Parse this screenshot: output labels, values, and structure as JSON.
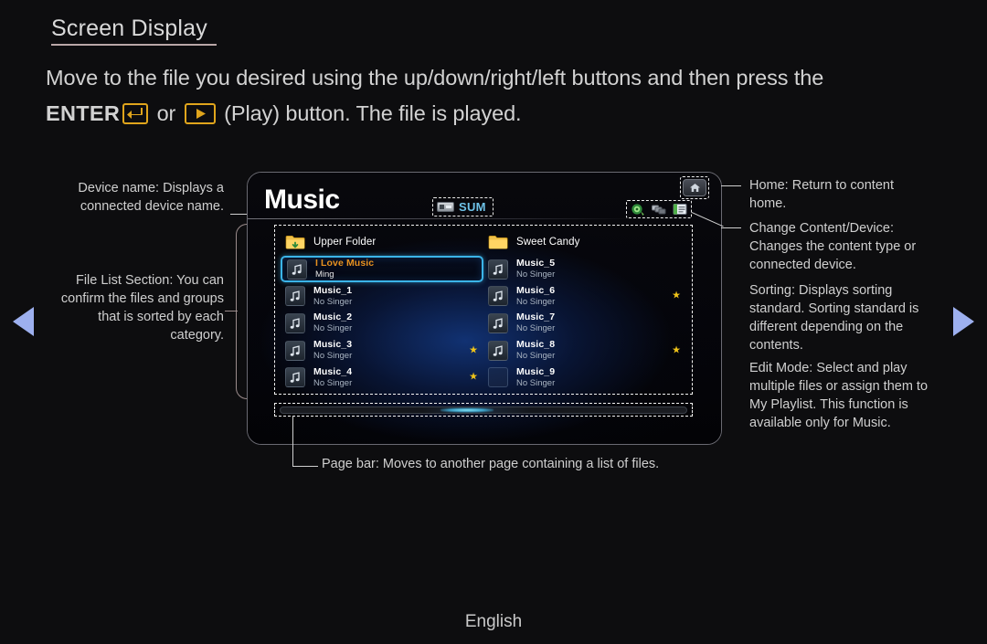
{
  "header": {
    "title": "Screen Display",
    "instruction_line1": "Move to the file you desired using the up/down/right/left buttons and then press the",
    "instruction_enter": "ENTER",
    "instruction_or": " or ",
    "instruction_tail": " (Play) button. The file is played."
  },
  "nav": {
    "prev_label": "Previous page",
    "next_label": "Next page"
  },
  "tv": {
    "title": "Music",
    "device_label": "SUM",
    "device_icon": "usb-drive-icon",
    "home_icon": "home-icon",
    "toolbar_icons": [
      {
        "name": "sorting-icon",
        "label": "Sorting"
      },
      {
        "name": "change-content-device-icon",
        "label": "Change Content/Device"
      },
      {
        "name": "edit-mode-icon",
        "label": "Edit Mode"
      }
    ],
    "left_column": [
      {
        "icon": "folder-up-icon",
        "title": "Upper Folder",
        "sub": "",
        "starred": false,
        "selected": false,
        "type": "folder"
      },
      {
        "icon": "music-note-icon",
        "title": "I Love Music",
        "sub": "Ming",
        "starred": false,
        "selected": true,
        "type": "music"
      },
      {
        "icon": "music-note-icon",
        "title": "Music_1",
        "sub": "No Singer",
        "starred": false,
        "selected": false,
        "type": "music"
      },
      {
        "icon": "music-note-icon",
        "title": "Music_2",
        "sub": "No Singer",
        "starred": false,
        "selected": false,
        "type": "music"
      },
      {
        "icon": "music-note-icon",
        "title": "Music_3",
        "sub": "No Singer",
        "starred": true,
        "selected": false,
        "type": "music"
      },
      {
        "icon": "music-note-icon",
        "title": "Music_4",
        "sub": "No Singer",
        "starred": true,
        "selected": false,
        "type": "music"
      }
    ],
    "right_column": [
      {
        "icon": "folder-icon",
        "title": "Sweet Candy",
        "sub": "",
        "starred": false,
        "selected": false,
        "type": "folder"
      },
      {
        "icon": "music-note-icon",
        "title": "Music_5",
        "sub": "No Singer",
        "starred": false,
        "selected": false,
        "type": "music"
      },
      {
        "icon": "music-note-icon",
        "title": "Music_6",
        "sub": "No Singer",
        "starred": true,
        "selected": false,
        "type": "music"
      },
      {
        "icon": "music-note-icon",
        "title": "Music_7",
        "sub": "No Singer",
        "starred": false,
        "selected": false,
        "type": "music"
      },
      {
        "icon": "music-note-icon",
        "title": "Music_8",
        "sub": "No Singer",
        "starred": true,
        "selected": false,
        "type": "music"
      },
      {
        "icon": "empty-icon",
        "title": "Music_9",
        "sub": "No Singer",
        "starred": false,
        "selected": false,
        "type": "empty"
      }
    ],
    "star_glyph": "★"
  },
  "callouts": {
    "device_name": "Device name: Displays a connected device name.",
    "file_list": "File List Section: You can confirm the files and groups that is sorted by each category.",
    "home": "Home: Return to content home.",
    "change_content": "Change Content/Device: Changes the content type or connected device.",
    "sorting": "Sorting: Displays sorting standard. Sorting standard is different depending on the contents.",
    "edit_mode": "Edit Mode: Select and play multiple files or assign them to My Playlist. This function is available only for Music.",
    "page_bar": "Page bar: Moves to another page containing a list of files."
  },
  "footer": {
    "language": "English"
  },
  "colors": {
    "background": "#0d0d0f",
    "accent_yellow": "#e0a51c",
    "accent_cyan": "#6ec2e8",
    "selection_border": "#3bb4e8",
    "selected_title": "#e7911f",
    "nav_arrow": "#9db0ef",
    "star": "#f0c419"
  }
}
